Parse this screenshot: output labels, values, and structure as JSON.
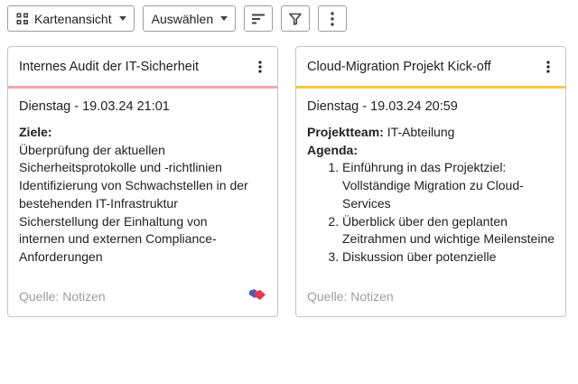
{
  "toolbar": {
    "view_label": "Kartenansicht",
    "select_label": "Auswählen",
    "sort_icon": "sort-icon",
    "filter_icon": "filter-icon",
    "more_icon": "more-vert-icon"
  },
  "cards": [
    {
      "title": "Internes Audit der IT-Sicherheit",
      "accent_color": "#f3a6ae",
      "date": "Dienstag - 19.03.24 21:01",
      "goals_label": "Ziele:",
      "lines": [
        "Überprüfung der aktuellen",
        "Sicherheitsprotokolle und -richtlinien",
        "Identifizierung von Schwachstellen in der",
        "bestehenden IT-Infrastruktur",
        "Sicherstellung der Einhaltung von",
        "internen und externen Compliance-",
        "Anforderungen"
      ],
      "source": "Quelle: Notizen",
      "source_icon": "tags-icon"
    },
    {
      "title": "Cloud-Migration Projekt Kick-off",
      "accent_color": "#f5c842",
      "date": "Dienstag - 19.03.24 20:59",
      "team_label": "Projektteam:",
      "team_value": "IT-Abteilung",
      "agenda_label": "Agenda:",
      "agenda": [
        "Einführung in das Projektziel: Vollständige Migration zu Cloud-Services",
        "Überblick über den geplanten Zeitrahmen und wichtige Meilensteine",
        "Diskussion über potenzielle"
      ],
      "source": "Quelle: Notizen"
    }
  ],
  "colors": {
    "tag_blue": "#3f5fb5",
    "tag_red": "#e53950"
  }
}
